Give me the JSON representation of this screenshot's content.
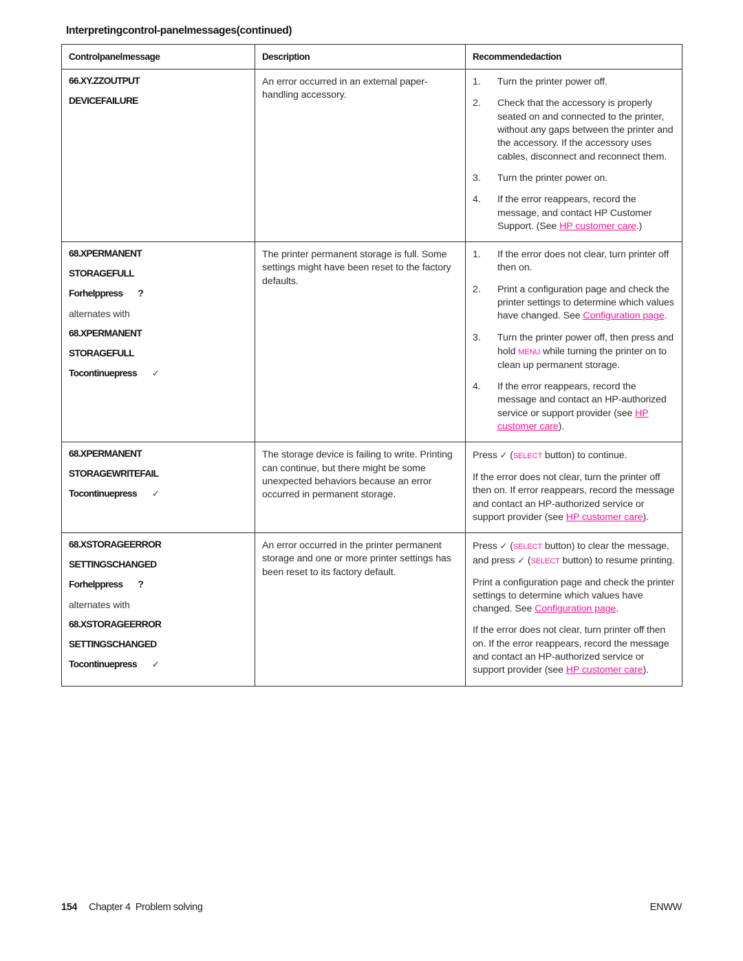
{
  "document": {
    "table_title": "Interpretingcontrol-panelmessages(continued)"
  },
  "table": {
    "headers": {
      "col1": "Controlpanelmessage",
      "col2": "Description",
      "col3": "Recommendedaction"
    },
    "rows": [
      {
        "message_lines": [
          "66.XY.ZZOUTPUT",
          "DEVICEFAILURE"
        ],
        "description": "An error occurred in an external paper-handling accessory.",
        "actions": [
          {
            "num": "1.",
            "text": "Turn the printer power off."
          },
          {
            "num": "2.",
            "text": "Check that the accessory is properly seated on and connected to the printer, without any gaps between the printer and the accessory. If the accessory uses cables, disconnect and reconnect them."
          },
          {
            "num": "3.",
            "text": "Turn the printer power on."
          },
          {
            "num": "4.",
            "text_before": "If the error reappears, record the message, and contact HP Customer Support. (See ",
            "link": "HP customer care",
            "text_after": ".)"
          }
        ]
      },
      {
        "message_lines": [
          "68.XPERMANENT",
          "STORAGEFULL"
        ],
        "help_prompt_label": "Forhelppress",
        "help_prompt_key": "?",
        "alternates_label": "alternates with",
        "message_lines_alt": [
          "68.XPERMANENT",
          "STORAGEFULL"
        ],
        "continue_prompt_label": "Tocontinuepress",
        "continue_prompt_key": "✓",
        "description": "The printer permanent storage is full. Some settings might have been reset to the factory defaults.",
        "actions": [
          {
            "num": "1.",
            "text": "If the error does not clear, turn printer off then on."
          },
          {
            "num": "2.",
            "text_before": "Print a configuration page and check the printer settings to determine which values have changed. See ",
            "link": "Configuration page",
            "text_after": "."
          },
          {
            "num": "3.",
            "text_before": "Turn the printer power off, then press and hold ",
            "keycap": "MENU",
            "text_after": " while turning the printer on to clean up permanent storage."
          },
          {
            "num": "4.",
            "text_before": "If the error reappears, record the message and contact an HP-authorized service or support provider (see ",
            "link": "HP customer care",
            "text_after": ")."
          }
        ]
      },
      {
        "message_lines": [
          "68.XPERMANENT",
          "STORAGEWRITEFAIL"
        ],
        "continue_prompt_label": "Tocontinuepress",
        "continue_prompt_key": "✓",
        "description": "The storage device is failing to write. Printing can continue, but there might be some unexpected behaviors because an error occurred in permanent storage.",
        "action_paragraphs": [
          {
            "pre": "Press ",
            "check": "✓",
            "mid": " (",
            "keycap": "SELECT",
            "post": " button) to continue."
          },
          {
            "pre": "If the error does not clear, turn the printer off then on. If error reappears, record the message and contact an HP-authorized service or support provider (see ",
            "link": "HP customer care",
            "post": ")."
          }
        ]
      },
      {
        "message_lines": [
          "68.XSTORAGEERROR",
          "SETTINGSCHANGED"
        ],
        "help_prompt_label": "Forhelppress",
        "help_prompt_key": "?",
        "alternates_label": "alternates with",
        "message_lines_alt": [
          "68.XSTORAGEERROR",
          "SETTINGSCHANGED"
        ],
        "continue_prompt_label": "Tocontinuepress",
        "continue_prompt_key": "✓",
        "description": "An error occurred in the printer permanent storage and one or more printer settings has been reset to its factory default.",
        "action_paragraphs": [
          {
            "pre": "Press ",
            "check": "✓",
            "mid": " (",
            "keycap": "SELECT",
            "mid2": " button) to clear the message, and press ",
            "check2": "✓",
            "mid3": " (",
            "keycap2": "SELECT",
            "post": " button) to resume printing."
          },
          {
            "pre": "Print a configuration page and check the printer settings to determine which values have changed. See ",
            "link": "Configuration page",
            "post": "."
          },
          {
            "pre": "If the error does not clear, turn printer off then on. If the error reappears, record the message and contact an HP-authorized service or support provider (see ",
            "link": "HP customer care",
            "post": ")."
          }
        ]
      }
    ]
  },
  "footer": {
    "page_number": "154",
    "chapter": "Chapter 4",
    "section": "Problem solving",
    "locale": "ENWW"
  },
  "colors": {
    "link": "#f5179b",
    "text": "#2a2a2a",
    "border": "#2b2b2b"
  }
}
